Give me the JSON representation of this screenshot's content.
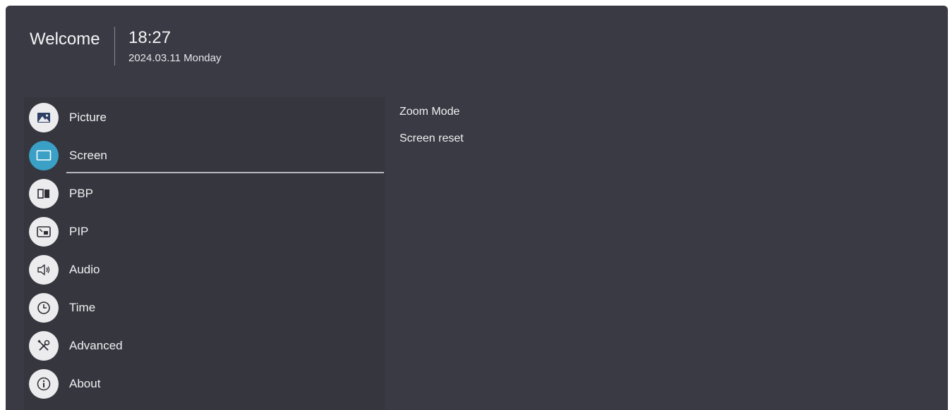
{
  "header": {
    "welcome": "Welcome",
    "time": "18:27",
    "date": "2024.03.11 Monday"
  },
  "menu": {
    "items": [
      {
        "label": "Picture",
        "icon": "picture-icon"
      },
      {
        "label": "Screen",
        "icon": "screen-icon",
        "active": true
      },
      {
        "label": "PBP",
        "icon": "pbp-icon"
      },
      {
        "label": "PIP",
        "icon": "pip-icon"
      },
      {
        "label": "Audio",
        "icon": "audio-icon"
      },
      {
        "label": "Time",
        "icon": "clock-icon"
      },
      {
        "label": "Advanced",
        "icon": "tools-icon"
      },
      {
        "label": "About",
        "icon": "info-icon"
      }
    ]
  },
  "submenu": {
    "items": [
      "Zoom Mode",
      "Screen reset"
    ]
  },
  "colors": {
    "background": "#3a3a44",
    "menu_background": "#36363f",
    "accent": "#3aa0c6",
    "icon_bg": "#ececee"
  }
}
